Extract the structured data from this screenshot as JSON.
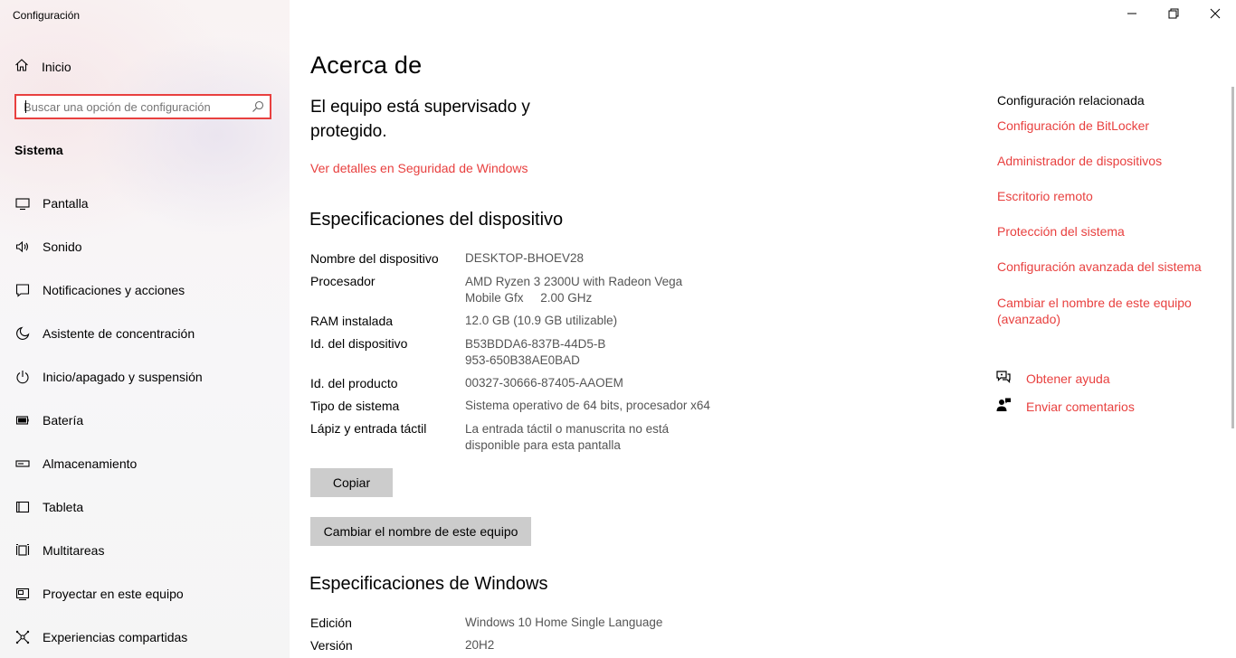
{
  "window": {
    "title": "Configuración",
    "controls": [
      "minimize-icon",
      "restore-icon",
      "close-icon"
    ]
  },
  "sidebar": {
    "home_label": "Inicio",
    "search_placeholder": "Buscar una opción de configuración",
    "section_title": "Sistema",
    "items": [
      {
        "label": "Pantalla",
        "icon": "display-icon"
      },
      {
        "label": "Sonido",
        "icon": "speaker-icon"
      },
      {
        "label": "Notificaciones y acciones",
        "icon": "notification-icon"
      },
      {
        "label": "Asistente de concentración",
        "icon": "moon-icon"
      },
      {
        "label": "Inicio/apagado y suspensión",
        "icon": "power-icon"
      },
      {
        "label": "Batería",
        "icon": "battery-icon"
      },
      {
        "label": "Almacenamiento",
        "icon": "storage-icon"
      },
      {
        "label": "Tableta",
        "icon": "tablet-icon"
      },
      {
        "label": "Multitareas",
        "icon": "multitask-icon"
      },
      {
        "label": "Proyectar en este equipo",
        "icon": "project-icon"
      },
      {
        "label": "Experiencias compartidas",
        "icon": "shared-icon"
      }
    ]
  },
  "main": {
    "title": "Acerca de",
    "status_heading": "El equipo está supervisado y protegido.",
    "security_link": "Ver detalles en Seguridad de Windows",
    "device_specs_title": "Especificaciones del dispositivo",
    "device_specs": [
      {
        "key": "Nombre del dispositivo",
        "value": "DESKTOP-BHOEV28"
      },
      {
        "key": "Procesador",
        "value": "AMD Ryzen 3 2300U with Radeon Vega Mobile Gfx     2.00 GHz"
      },
      {
        "key": "RAM instalada",
        "value": "12.0 GB (10.9 GB utilizable)"
      },
      {
        "key": "Id. del dispositivo",
        "value": "B53BDDA6-837B-44D5-B953-650B38AE0BAD"
      },
      {
        "key": "Id. del producto",
        "value": "00327-30666-87405-AAOEM"
      },
      {
        "key": "Tipo de sistema",
        "value": "Sistema operativo de 64 bits, procesador x64"
      },
      {
        "key": "Lápiz y entrada táctil",
        "value": "La entrada táctil o manuscrita no está disponible para esta pantalla"
      }
    ],
    "copy_button": "Copiar",
    "rename_button": "Cambiar el nombre de este equipo",
    "windows_specs_title": "Especificaciones de Windows",
    "windows_specs": [
      {
        "key": "Edición",
        "value": "Windows 10 Home Single Language"
      },
      {
        "key": "Versión",
        "value": "20H2"
      }
    ]
  },
  "related": {
    "title": "Configuración relacionada",
    "links": [
      "Configuración de BitLocker",
      "Administrador de dispositivos",
      "Escritorio remoto",
      "Protección del sistema",
      "Configuración avanzada del sistema",
      "Cambiar el nombre de este equipo (avanzado)"
    ],
    "help_links": [
      {
        "label": "Obtener ayuda",
        "icon": "help-chat-icon"
      },
      {
        "label": "Enviar comentarios",
        "icon": "feedback-icon"
      }
    ]
  },
  "colors": {
    "accent": "#e8403f",
    "button_bg": "#cccccc",
    "secondary_text": "#555555"
  }
}
